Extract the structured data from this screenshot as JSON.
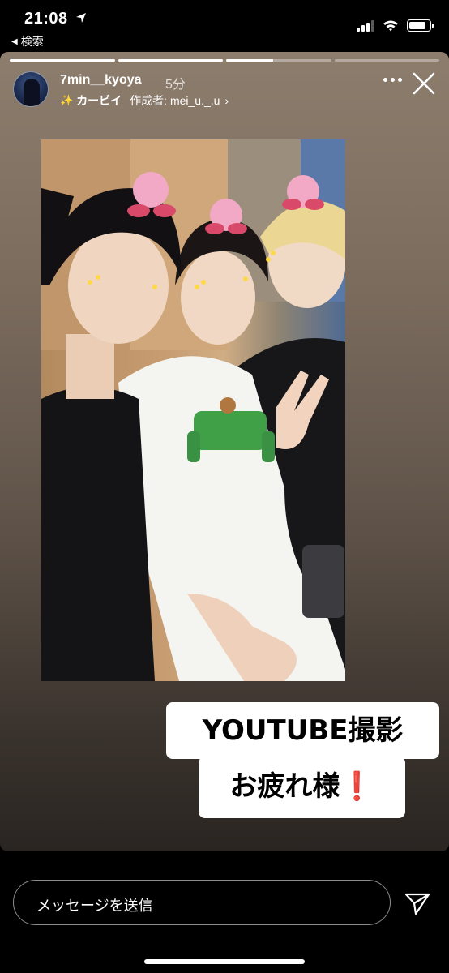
{
  "status_bar": {
    "time": "21:08",
    "back_label": "検索",
    "battery_level": 0.92,
    "signal_bars": 3
  },
  "story": {
    "progress_segments": [
      1,
      1,
      0.45,
      0
    ],
    "username": "7min__kyoya",
    "time_ago": "5分",
    "effect_name": "カービイ",
    "effect_author_label": "作成者: mei_u._.u",
    "stickers": {
      "line1": "YOUTUBE撮影",
      "line2": "お疲れ様",
      "line2_mark": "❗"
    }
  },
  "footer": {
    "message_placeholder": "メッセージを送信"
  },
  "icons": {
    "more": "more-dots-icon",
    "close": "close-icon",
    "send": "send-icon",
    "location": "location-arrow-icon"
  },
  "colors": {
    "sticker_accent": "#e0242b",
    "story_background": "#7a6b5d"
  }
}
